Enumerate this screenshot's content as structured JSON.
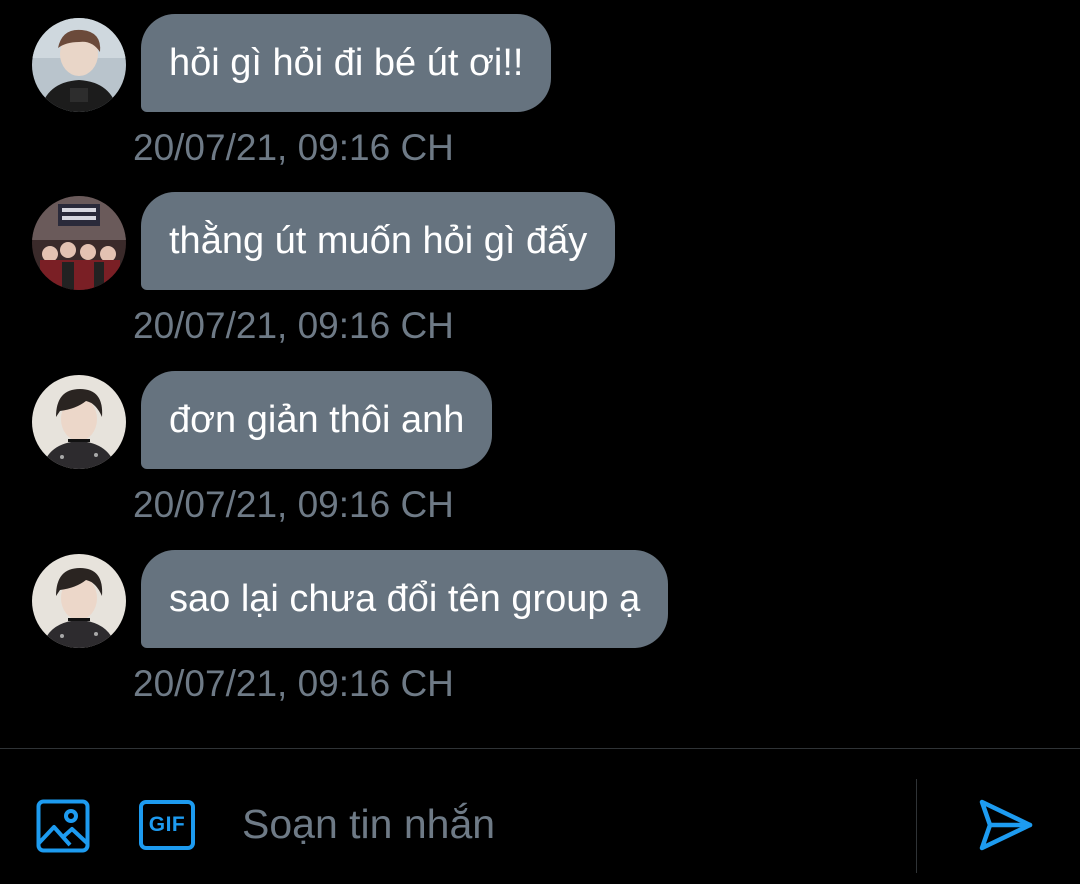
{
  "colors": {
    "background": "#000000",
    "bubble": "#66737f",
    "timestamp": "#6e7a86",
    "accent": "#1d9bf0",
    "divider": "#2f3336"
  },
  "messages": [
    {
      "text": "hỏi gì hỏi đi bé út ơi!!",
      "time": "20/07/21, 09:16 CH",
      "avatar": "avatar-person-black-hoodie"
    },
    {
      "text": "thằng út muốn hỏi gì đấy",
      "time": "20/07/21, 09:16 CH",
      "avatar": "avatar-group-photo"
    },
    {
      "text": "đơn giản thôi anh",
      "time": "20/07/21, 09:16 CH",
      "avatar": "avatar-person-dark-hair"
    },
    {
      "text": "sao lại chưa đổi tên group ạ",
      "time": "20/07/21, 09:16 CH",
      "avatar": "avatar-person-dark-hair"
    }
  ],
  "composer": {
    "media_icon": "image-icon",
    "gif_label": "GIF",
    "placeholder": "Soạn tin nhắn",
    "value": "",
    "send_icon": "send-icon"
  }
}
